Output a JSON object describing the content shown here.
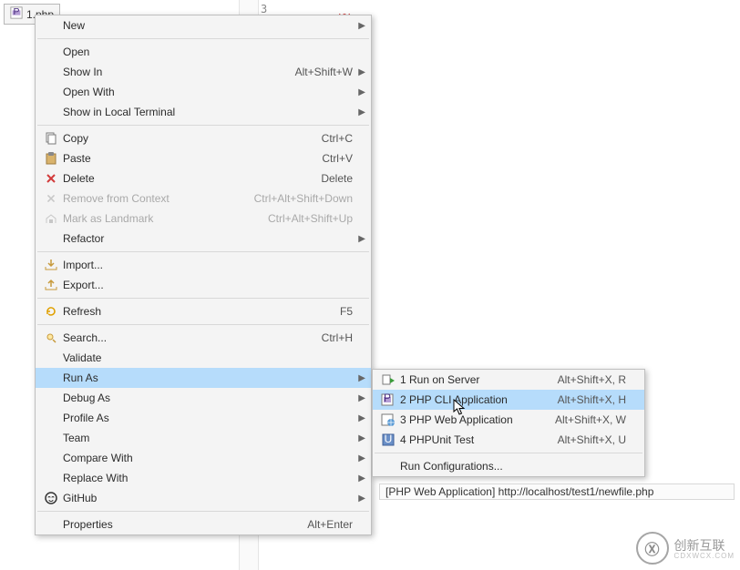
{
  "file_tab": {
    "label": "1.php",
    "icon": "php-file-icon"
  },
  "line_number": "3",
  "context_menu": {
    "items": [
      {
        "label": "New",
        "submenu": true
      },
      {
        "sep": true
      },
      {
        "label": "Open"
      },
      {
        "label": "Show In",
        "accel": "Alt+Shift+W",
        "submenu": true
      },
      {
        "label": "Open With",
        "submenu": true
      },
      {
        "label": "Show in Local Terminal",
        "submenu": true
      },
      {
        "sep": true
      },
      {
        "label": "Copy",
        "accel": "Ctrl+C",
        "icon": "copy-icon"
      },
      {
        "label": "Paste",
        "accel": "Ctrl+V",
        "icon": "paste-icon"
      },
      {
        "label": "Delete",
        "accel": "Delete",
        "icon": "delete-icon"
      },
      {
        "label": "Remove from Context",
        "accel": "Ctrl+Alt+Shift+Down",
        "icon": "remove-context-icon",
        "disabled": true
      },
      {
        "label": "Mark as Landmark",
        "accel": "Ctrl+Alt+Shift+Up",
        "icon": "landmark-icon",
        "disabled": true
      },
      {
        "label": "Refactor",
        "submenu": true
      },
      {
        "sep": true
      },
      {
        "label": "Import...",
        "icon": "import-icon"
      },
      {
        "label": "Export...",
        "icon": "export-icon"
      },
      {
        "sep": true
      },
      {
        "label": "Refresh",
        "accel": "F5",
        "icon": "refresh-icon"
      },
      {
        "sep": true
      },
      {
        "label": "Search...",
        "accel": "Ctrl+H",
        "icon": "search-icon"
      },
      {
        "label": "Validate"
      },
      {
        "label": "Run As",
        "submenu": true,
        "highlighted": true
      },
      {
        "label": "Debug As",
        "submenu": true
      },
      {
        "label": "Profile As",
        "submenu": true
      },
      {
        "label": "Team",
        "submenu": true
      },
      {
        "label": "Compare With",
        "submenu": true
      },
      {
        "label": "Replace With",
        "submenu": true
      },
      {
        "label": "GitHub",
        "icon": "github-icon",
        "submenu": true
      },
      {
        "sep": true
      },
      {
        "label": "Properties",
        "accel": "Alt+Enter"
      }
    ]
  },
  "run_as_submenu": {
    "items": [
      {
        "label": "1 Run on Server",
        "accel": "Alt+Shift+X, R",
        "icon": "server-run-icon"
      },
      {
        "label": "2 PHP CLI Application",
        "accel": "Alt+Shift+X, H",
        "icon": "php-cli-icon",
        "highlighted": true
      },
      {
        "label": "3 PHP Web Application",
        "accel": "Alt+Shift+X, W",
        "icon": "php-web-icon"
      },
      {
        "label": "4 PHPUnit Test",
        "accel": "Alt+Shift+X, U",
        "icon": "phpunit-icon"
      },
      {
        "sep": true
      },
      {
        "label": "Run Configurations..."
      }
    ]
  },
  "status_bar": {
    "text": "[PHP Web Application] http://localhost/test1/newfile.php"
  },
  "watermark": {
    "text": "创新互联",
    "sub": "CDXWCX.COM"
  }
}
